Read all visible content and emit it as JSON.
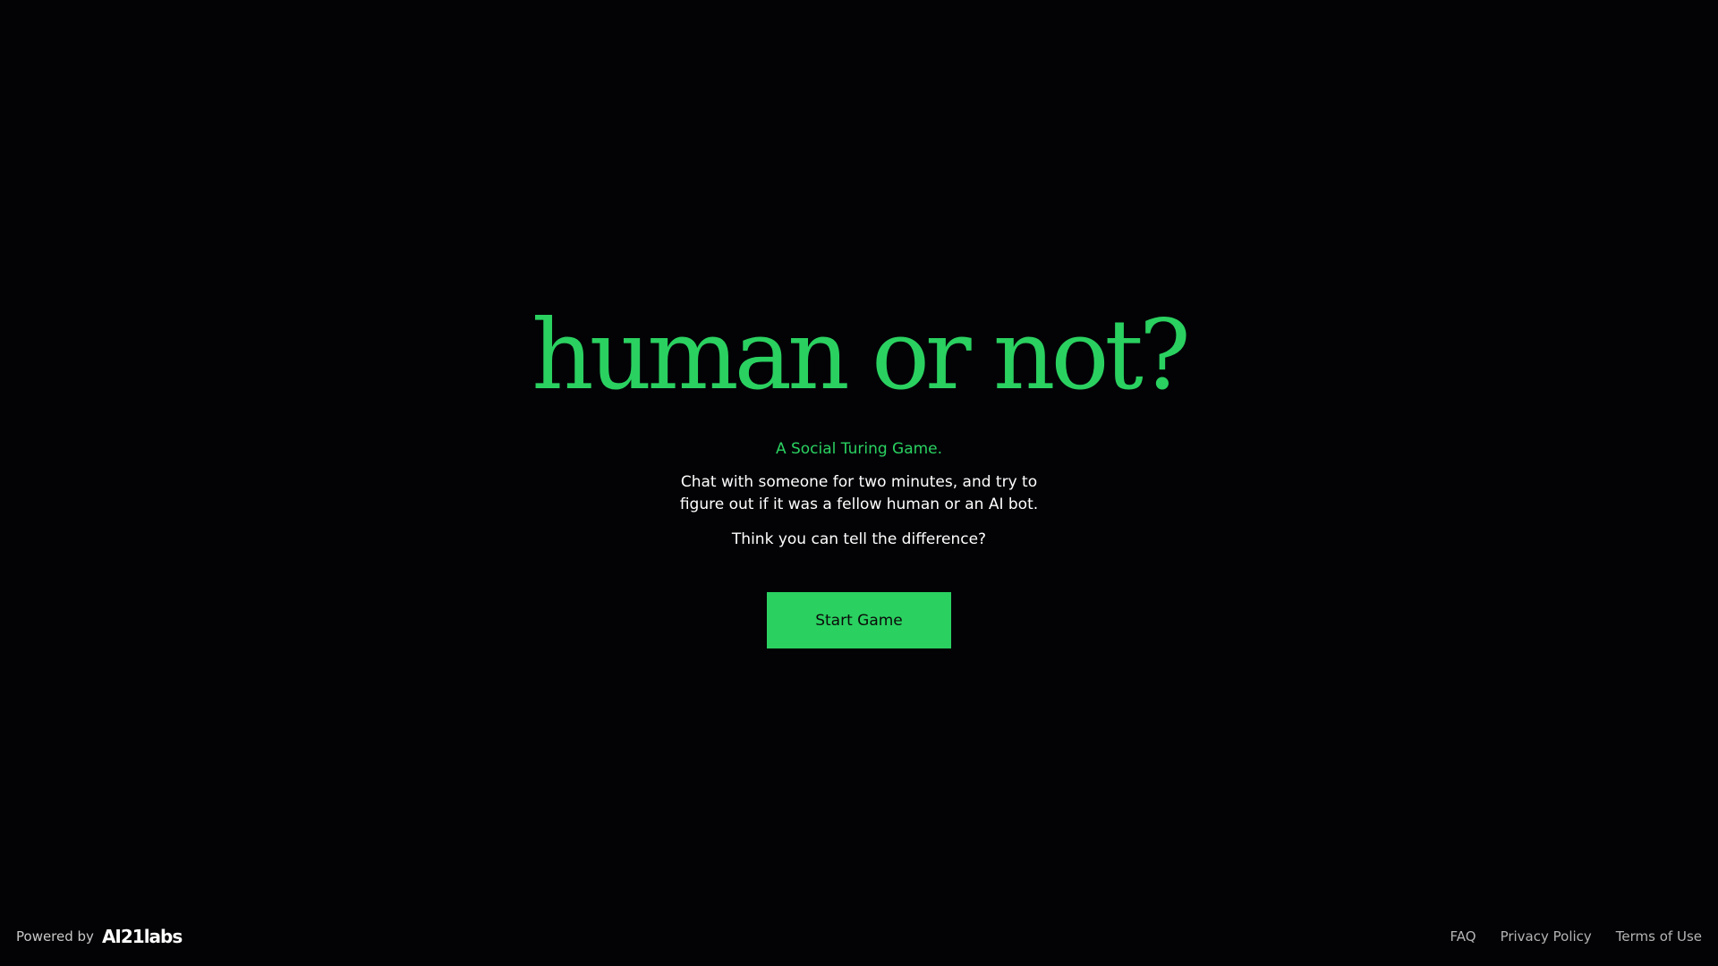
{
  "hero": {
    "title": "human or not?",
    "subtitle": "A Social Turing Game.",
    "description": "Chat with someone for two minutes, and try to figure out if it was a fellow human or an AI bot.",
    "question": "Think you can tell the difference?",
    "start_button_label": "Start Game"
  },
  "footer": {
    "powered_by_label": "Powered by",
    "logo_text": "AI21labs",
    "links": [
      {
        "label": "FAQ"
      },
      {
        "label": "Privacy Policy"
      },
      {
        "label": "Terms of Use"
      }
    ]
  },
  "colors": {
    "background": "#030306",
    "accent": "#2ad160",
    "text": "#ffffff",
    "muted_text": "#b4b4b4"
  }
}
